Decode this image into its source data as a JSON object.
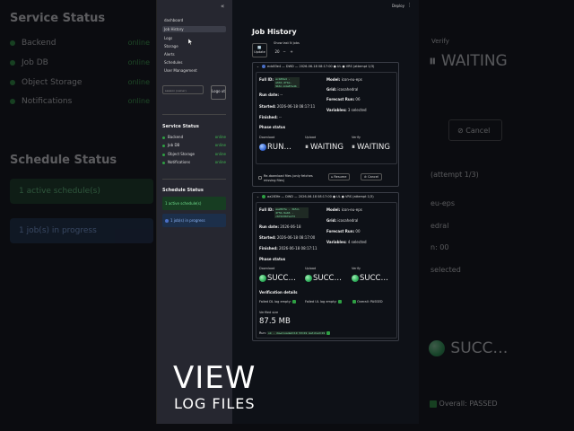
{
  "background": {
    "service_status_title": "Service Status",
    "services": [
      {
        "name": "Backend",
        "status": "online"
      },
      {
        "name": "Job DB",
        "status": "online"
      },
      {
        "name": "Object Storage",
        "status": "online"
      },
      {
        "name": "Notifications",
        "status": "online"
      }
    ],
    "schedule_status_title": "Schedule Status",
    "active_schedules": "1 active schedule(s)",
    "jobs_in_progress": "1 job(s) in progress",
    "verify_label": "Verify",
    "waiting": "WAITING",
    "cancel": "Cancel",
    "attempt": "(attempt 1/3)",
    "eu_eps": "eu-eps",
    "edral": "edral",
    "runs": "n: 00",
    "selected": "selected",
    "success": "SUCC…",
    "overall": "Overall: PASSED"
  },
  "sidebar": {
    "nav": [
      "dashboard",
      "Job History",
      "Logs",
      "Storage",
      "Alerts",
      "Schedules",
      "User Management"
    ],
    "active_index": 1,
    "input_placeholder": "session (owner)",
    "login_label": "Logo ut",
    "service_status_title": "Service Status",
    "services": [
      {
        "name": "Backend",
        "status": "online"
      },
      {
        "name": "Job DB",
        "status": "online"
      },
      {
        "name": "Object Storage",
        "status": "online"
      },
      {
        "name": "Notifications",
        "status": "online"
      }
    ],
    "schedule_status_title": "Schedule Status",
    "active_schedules": "1 active schedule(s)",
    "jobs_in_progress": "1 job(s) in progress"
  },
  "header": {
    "deploy": "Deploy",
    "menu": "⋮",
    "collapse": "«"
  },
  "main": {
    "title": "Job History",
    "update_label": "Update",
    "show_last_label": "Show last N jobs",
    "show_last_value": "20",
    "jobs": [
      {
        "header": "ecb83e4 — DWD — 2026-06-18 08:17:00 ● UL ● VRS (attempt 1/3)",
        "full_id_label": "Full ID:",
        "full_id": "ecb83e4 · e661-4fbe-9b6c-b4a8fa4b",
        "model_label": "Model:",
        "model": "icon-eu-eps",
        "run_date_label": "Run date:",
        "run_date": "--",
        "grid_label": "Grid:",
        "grid": "icosahedral",
        "started_label": "Started:",
        "started": "2026-06-18 08:17:11",
        "forecast_label": "Forecast Run:",
        "forecast": "06",
        "finished_label": "Finished:",
        "finished": "--",
        "variables_label": "Variables:",
        "variables": "3 selected",
        "phase_status_label": "Phase status",
        "phases": [
          {
            "name": "Download",
            "value": "RUN…",
            "icon": "blue-orb"
          },
          {
            "name": "Upload",
            "value": "WAITING",
            "icon": "pause"
          },
          {
            "name": "Verify",
            "value": "WAITING",
            "icon": "pause"
          }
        ],
        "redownload_label": "Re-download files (only fetches missing files)",
        "resume_label": "Resume",
        "cancel_label": "Cancel"
      },
      {
        "header": "aa283fe — DWD — 2026-06-18 08:17:00 ● UL ● VRS (attempt 1/3)",
        "full_id_label": "Full ID:",
        "full_id": "aa283fe · 3b5d-4f5b-9ab6 · c6f4336fa1f3",
        "model_label": "Model:",
        "model": "icon-eu-eps",
        "run_date_label": "Run date:",
        "run_date": "2026-06-18",
        "grid_label": "Grid:",
        "grid": "icosahedral",
        "started_label": "Started:",
        "started": "2026-06-18 08:17:00",
        "forecast_label": "Forecast Run:",
        "forecast": "00",
        "finished_label": "Finished:",
        "finished": "2026-06-18 08:17:11",
        "variables_label": "Variables:",
        "variables": "4 selected",
        "phase_status_label": "Phase status",
        "phases": [
          {
            "name": "Download",
            "value": "SUCC…",
            "icon": "green-orb"
          },
          {
            "name": "Upload",
            "value": "SUCC…",
            "icon": "green-orb"
          },
          {
            "name": "Verify",
            "value": "SUCC…",
            "icon": "green-orb"
          }
        ],
        "verification_label": "Verification details",
        "failed_dl": "Failed DL log empty:",
        "failed_ul": "Failed UL log empty:",
        "overall": "Overall: PASSED",
        "verified_size_label": "Verified size",
        "verified_size": "87.5 MB",
        "run_line_prefix": "Run:",
        "run_line_code": "ok · downloaded=19 53=19 matched=19"
      }
    ]
  },
  "caption": {
    "big": "VIEW",
    "small": "LOG FILES"
  },
  "colors": {
    "success": "#2ea043",
    "info": "#1c2f4a",
    "sidebar_bg": "#262730",
    "main_bg": "#0e1117"
  }
}
